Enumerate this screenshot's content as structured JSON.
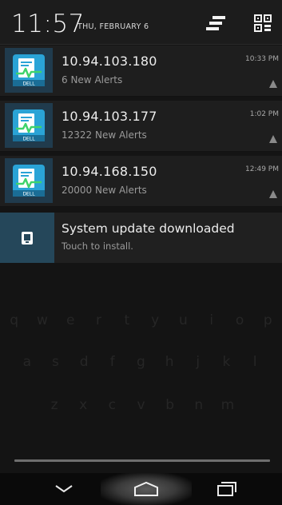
{
  "status": {
    "clock": "11:57",
    "date": "THU, FEBRUARY 6"
  },
  "header_icons": {
    "clear": "clear-all-icon",
    "quick_settings": "quick-settings-icon"
  },
  "notifications": [
    {
      "title": "10.94.103.180",
      "subtitle": "6 New Alerts",
      "time": "10:33 PM",
      "icon": "dell-monitor-icon",
      "small_icon": "warning-icon"
    },
    {
      "title": "10.94.103.177",
      "subtitle": "12322 New Alerts",
      "time": "1:02 PM",
      "icon": "dell-monitor-icon",
      "small_icon": "warning-icon"
    },
    {
      "title": "10.94.168.150",
      "subtitle": "20000 New Alerts",
      "time": "12:49 PM",
      "icon": "dell-monitor-icon",
      "small_icon": "warning-icon"
    }
  ],
  "system_update": {
    "title": "System update downloaded",
    "subtitle": "Touch to install.",
    "icon": "system-update-icon"
  },
  "icon_label": "DELL",
  "keyboard": {
    "row1": [
      "q",
      "w",
      "e",
      "r",
      "t",
      "y",
      "u",
      "i",
      "o",
      "p"
    ],
    "row2": [
      "a",
      "s",
      "d",
      "f",
      "g",
      "h",
      "j",
      "k",
      "l"
    ],
    "row3": [
      "z",
      "x",
      "c",
      "v",
      "b",
      "n",
      "m"
    ]
  },
  "nav": {
    "back": "back-icon",
    "home": "home-icon",
    "recent": "recent-apps-icon"
  },
  "colors": {
    "panel_bg": "#141414",
    "notif_bg": "#1e1e1e",
    "app_icon_bg": "#203b4d",
    "accent_blue": "#2aa3d6",
    "accent_green": "#3fd36b"
  }
}
